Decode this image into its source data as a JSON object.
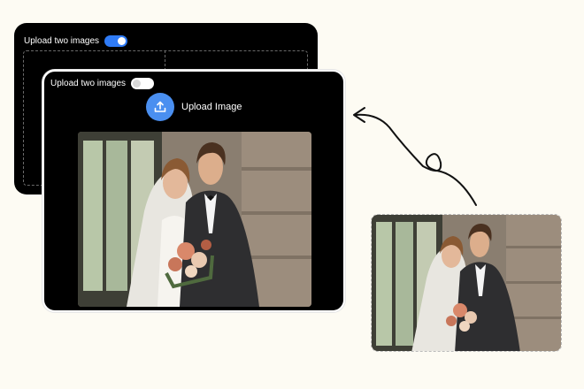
{
  "back_panel": {
    "toggle_label": "Upload two images",
    "toggle_state": "on"
  },
  "front_panel": {
    "toggle_label": "Upload two images",
    "toggle_state": "off",
    "upload_button_label": "Upload Image",
    "upload_icon": "upload-icon"
  },
  "colors": {
    "background": "#fdfbf3",
    "panel": "#000000",
    "accent": "#2f7bf6",
    "upload_circle": "#4a8ff0"
  }
}
